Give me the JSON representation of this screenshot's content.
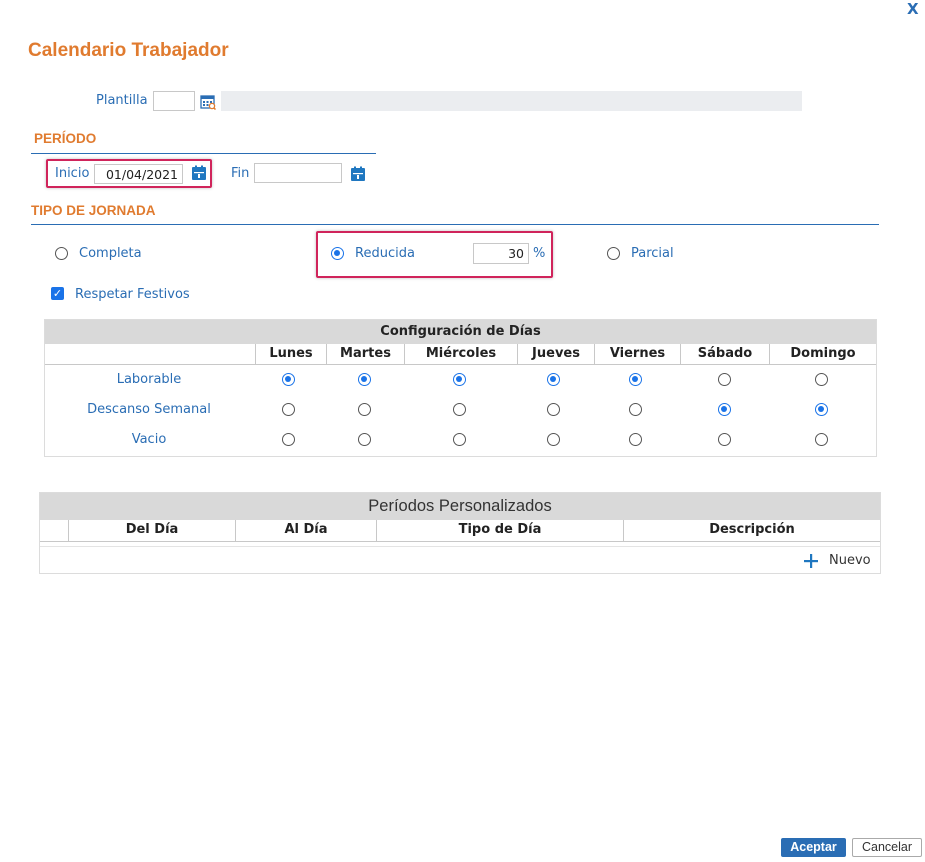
{
  "window": {
    "title": "Calendario Trabajador",
    "close_label": "X"
  },
  "plantilla": {
    "label": "Plantilla",
    "code": "",
    "description": ""
  },
  "periodo": {
    "section_title": "PERÍODO",
    "inicio_label": "Inicio",
    "inicio_value": "01/04/2021",
    "fin_label": "Fin",
    "fin_value": ""
  },
  "tipo_jornada": {
    "section_title": "TIPO DE JORNADA",
    "options": [
      {
        "label": "Completa",
        "selected": false
      },
      {
        "label": "Reducida",
        "selected": true
      },
      {
        "label": "Parcial",
        "selected": false
      }
    ],
    "percentage_value": "30",
    "percentage_unit": "%",
    "respetar_festivos_label": "Respetar Festivos",
    "respetar_festivos_checked": true
  },
  "config_dias": {
    "title": "Configuración de Días",
    "days": [
      "Lunes",
      "Martes",
      "Miércoles",
      "Jueves",
      "Viernes",
      "Sábado",
      "Domingo"
    ],
    "rows": [
      {
        "label": "Laborable",
        "selected": [
          true,
          true,
          true,
          true,
          true,
          false,
          false
        ]
      },
      {
        "label": "Descanso Semanal",
        "selected": [
          false,
          false,
          false,
          false,
          false,
          true,
          true
        ]
      },
      {
        "label": "Vacio",
        "selected": [
          false,
          false,
          false,
          false,
          false,
          false,
          false
        ]
      }
    ]
  },
  "periodos": {
    "title": "Períodos Personalizados",
    "columns": [
      "Del Día",
      "Al Día",
      "Tipo de Día",
      "Descripción"
    ],
    "new_label": "Nuevo"
  },
  "footer": {
    "accept_label": "Aceptar",
    "cancel_label": "Cancelar"
  },
  "colors": {
    "accent": "#e07b2f",
    "link": "#2a6db4",
    "radio": "#1a73e8",
    "highlight": "#d0245b"
  }
}
